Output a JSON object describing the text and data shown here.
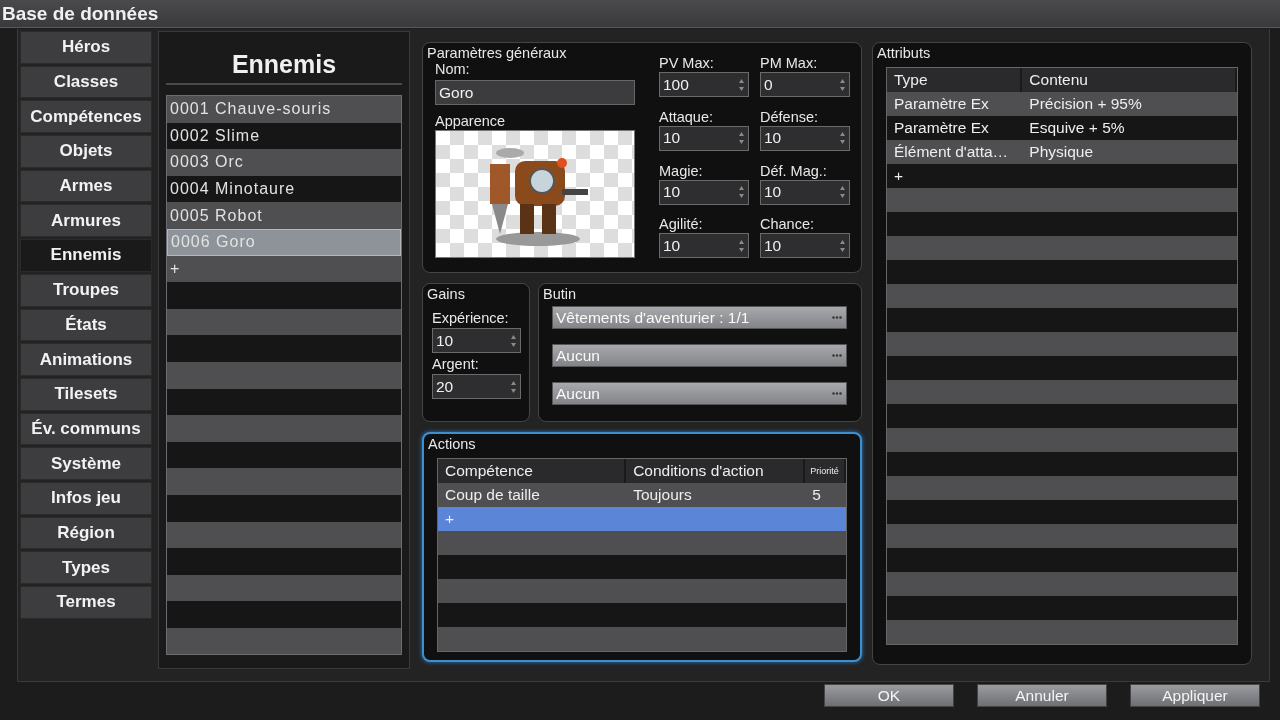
{
  "window": {
    "title": "Base de données"
  },
  "nav": [
    {
      "label": "Héros",
      "selected": false
    },
    {
      "label": "Classes",
      "selected": false
    },
    {
      "label": "Compétences",
      "selected": false
    },
    {
      "label": "Objets",
      "selected": false
    },
    {
      "label": "Armes",
      "selected": false
    },
    {
      "label": "Armures",
      "selected": false
    },
    {
      "label": "Ennemis",
      "selected": true
    },
    {
      "label": "Troupes",
      "selected": false
    },
    {
      "label": "États",
      "selected": false
    },
    {
      "label": "Animations",
      "selected": false
    },
    {
      "label": "Tilesets",
      "selected": false
    },
    {
      "label": "Év. communs",
      "selected": false
    },
    {
      "label": "Système",
      "selected": false
    },
    {
      "label": "Infos jeu",
      "selected": false
    },
    {
      "label": "Région",
      "selected": false
    },
    {
      "label": "Types",
      "selected": false
    },
    {
      "label": "Termes",
      "selected": false
    }
  ],
  "enemy_list": {
    "title": "Ennemis",
    "items": [
      {
        "label": "0001 Chauve-souris",
        "selected": false
      },
      {
        "label": "0002 Slime",
        "selected": false
      },
      {
        "label": "0003 Orc",
        "selected": false
      },
      {
        "label": "0004 Minotaure",
        "selected": false
      },
      {
        "label": "0005 Robot",
        "selected": false
      },
      {
        "label": "0006 Goro",
        "selected": true
      }
    ],
    "add": "+"
  },
  "general": {
    "title": "Paramètres généraux",
    "name_label": "Nom:",
    "name": "Goro",
    "appearance_label": "Apparence",
    "stats": [
      {
        "label": "PV Max:",
        "value": "100"
      },
      {
        "label": "PM Max:",
        "value": "0"
      },
      {
        "label": "Attaque:",
        "value": "10"
      },
      {
        "label": "Défense:",
        "value": "10"
      },
      {
        "label": "Magie:",
        "value": "10"
      },
      {
        "label": "Déf. Mag.:",
        "value": "10"
      },
      {
        "label": "Agilité:",
        "value": "10"
      },
      {
        "label": "Chance:",
        "value": "10"
      }
    ]
  },
  "gains": {
    "title": "Gains",
    "fields": [
      {
        "label": "Expérience:",
        "value": "10"
      },
      {
        "label": "Argent:",
        "value": "20"
      }
    ]
  },
  "loot": {
    "title": "Butin",
    "items": [
      "Vêtements d'aventurier : 1/1",
      "Aucun",
      "Aucun"
    ]
  },
  "actions": {
    "title": "Actions",
    "columns": [
      "Compétence",
      "Conditions d'action",
      "Priorité"
    ],
    "rows": [
      {
        "cells": [
          "Coup de taille",
          "Toujours",
          "5"
        ],
        "selected": false
      },
      {
        "cells": [
          "+"
        ],
        "selected": true
      }
    ]
  },
  "attributes": {
    "title": "Attributs",
    "columns": [
      "Type",
      "Contenu"
    ],
    "rows": [
      {
        "cells": [
          "Paramètre Ex",
          "Précision + 95%"
        ]
      },
      {
        "cells": [
          "Paramètre Ex",
          "Esquive + 5%"
        ]
      },
      {
        "cells": [
          "Élément d'atta…",
          "Physique"
        ]
      },
      {
        "cells": [
          "+"
        ]
      }
    ]
  },
  "buttons": [
    "OK",
    "Annuler",
    "Appliquer"
  ]
}
